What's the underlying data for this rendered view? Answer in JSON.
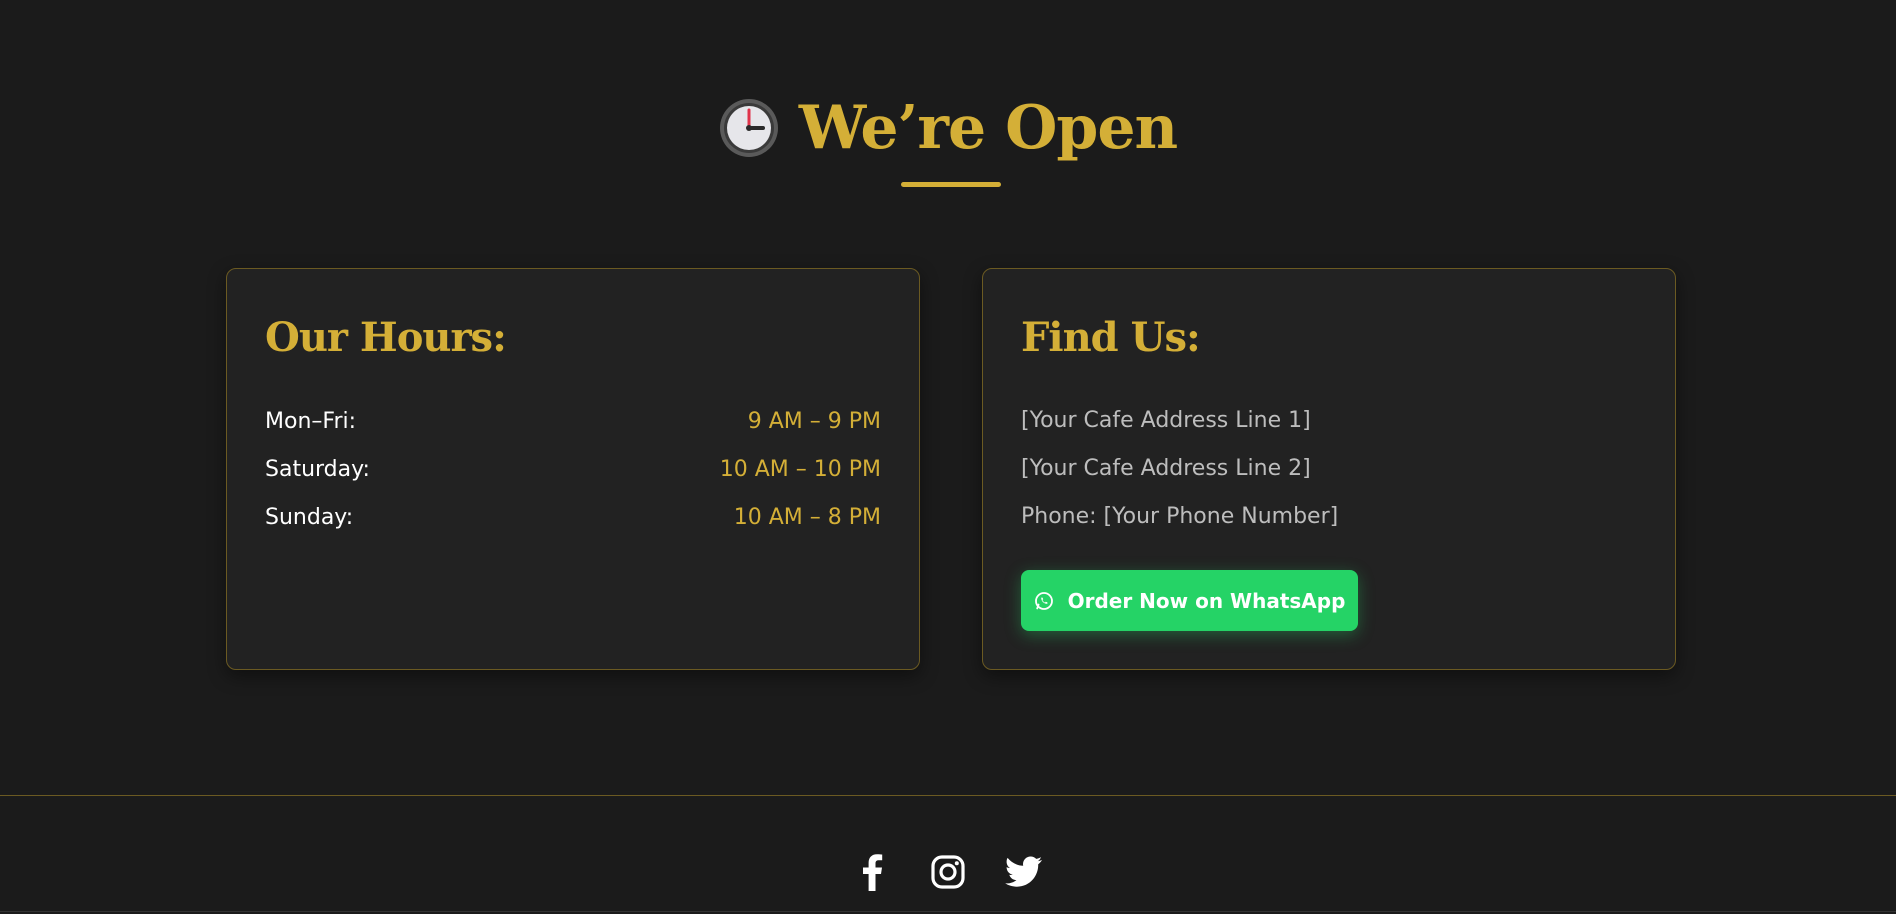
{
  "section": {
    "heading": "We’re Open",
    "heading_icon": "clock-icon"
  },
  "hours_card": {
    "title": "Our Hours:",
    "rows": [
      {
        "day": "Mon–Fri:",
        "time": "9 AM – 9 PM"
      },
      {
        "day": "Saturday:",
        "time": "10 AM – 10 PM"
      },
      {
        "day": "Sunday:",
        "time": "10 AM – 8 PM"
      }
    ]
  },
  "find_card": {
    "title": "Find Us:",
    "address_line_1": "[Your Cafe Address Line 1]",
    "address_line_2": "[Your Cafe Address Line 2]",
    "phone": "Phone: [Your Phone Number]",
    "button_label": "Order Now on WhatsApp",
    "button_icon": "whatsapp-icon"
  },
  "footer": {
    "social_icons": [
      "facebook-icon",
      "instagram-icon",
      "twitter-icon"
    ]
  },
  "colors": {
    "background": "#1b1b1b",
    "card": "#222222",
    "accent_gold": "#d4af37",
    "whatsapp_green": "#25d366",
    "muted_text": "#bdbdbd"
  }
}
